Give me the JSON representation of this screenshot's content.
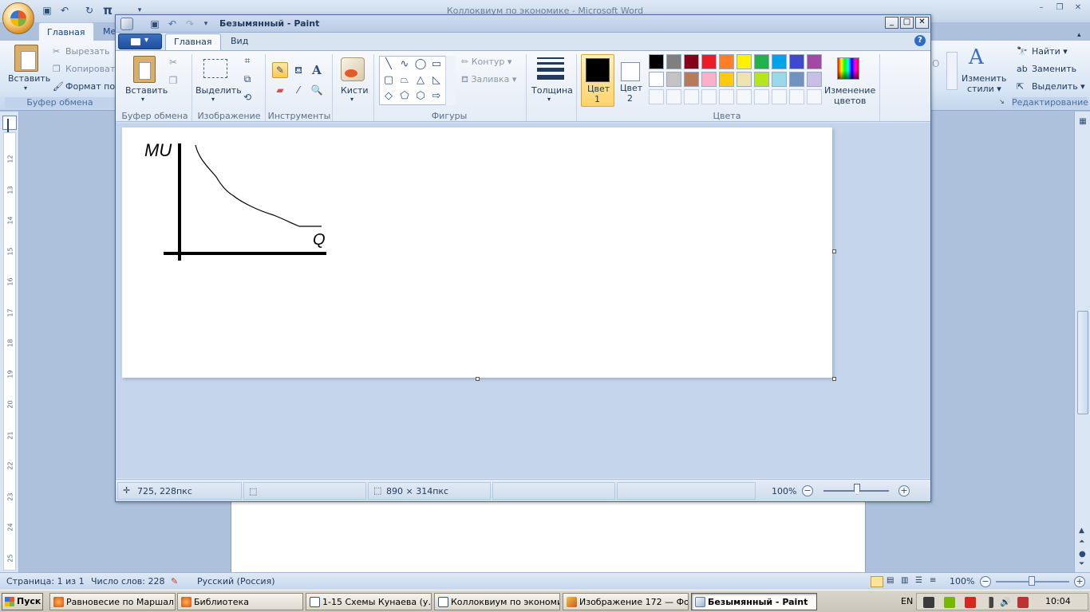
{
  "word": {
    "title": "Коллоквиум по экономике - Microsoft Word",
    "tabs": [
      {
        "label": "Главная"
      },
      {
        "label": "Ме"
      }
    ],
    "clipboard": {
      "paste": "Вставить",
      "cut": "Вырезать",
      "copy": "Копировать",
      "format": "Формат по о",
      "group": "Буфер обмена"
    },
    "styles": {
      "change": "Изменить",
      "change2": "стили ▾"
    },
    "editing": {
      "find": "Найти ▾",
      "replace": "Заменить",
      "select": "Выделить ▾",
      "group": "Редактирование"
    },
    "ruler_numbers": [
      "12",
      "13",
      "14",
      "15",
      "16",
      "17",
      "18",
      "19",
      "20",
      "21",
      "22",
      "23",
      "24",
      "25"
    ],
    "status": {
      "page": "Страница: 1 из 1",
      "words": "Число слов: 228",
      "language": "Русский (Россия)",
      "zoom": "100%"
    }
  },
  "paint": {
    "title": "Безымянный - Paint",
    "tabs": [
      {
        "label": "Главная"
      },
      {
        "label": "Вид"
      }
    ],
    "ribbon": {
      "clipboard": {
        "paste": "Вставить",
        "group": "Буфер обмена"
      },
      "image": {
        "select": "Выделить",
        "group": "Изображение"
      },
      "tools": {
        "group": "Инструменты"
      },
      "brushes": {
        "label": "Кисти"
      },
      "shapes": {
        "outline": "Контур",
        "fill": "Заливка",
        "group": "Фигуры"
      },
      "thickness": {
        "label": "Толщина"
      },
      "color1": {
        "label": "Цвет",
        "num": "1"
      },
      "color2": {
        "label": "Цвет",
        "num": "2"
      },
      "edit_colors": {
        "line1": "Изменение",
        "line2": "цветов"
      },
      "colors_group": "Цвета",
      "palette": [
        "#000000",
        "#7f7f7f",
        "#880015",
        "#ed1c24",
        "#ff7f27",
        "#fff200",
        "#22b14c",
        "#00a2e8",
        "#3f48cc",
        "#a349a4",
        "#ffffff",
        "#c3c3c3",
        "#b97a57",
        "#ffaec9",
        "#ffc90e",
        "#efe4b0",
        "#b5e61d",
        "#99d9ea",
        "#7092be",
        "#c8bfe7"
      ]
    },
    "canvas": {
      "y_label": "MU",
      "x_label": "Q"
    },
    "status": {
      "cursor": "725, 228пкс",
      "size": "890 × 314пкс",
      "zoom": "100%"
    }
  },
  "taskbar": {
    "start": "Пуск",
    "tasks": [
      {
        "label": "Равновесие по Маршал..."
      },
      {
        "label": "Библиотека"
      },
      {
        "label": "1-15 Схемы Кунаева (у..."
      },
      {
        "label": "Коллоквиум по экономи..."
      },
      {
        "label": "Изображение 172 — Фо..."
      },
      {
        "label": "Безымянный - Paint"
      }
    ],
    "lang": "EN",
    "clock": "10:04"
  }
}
